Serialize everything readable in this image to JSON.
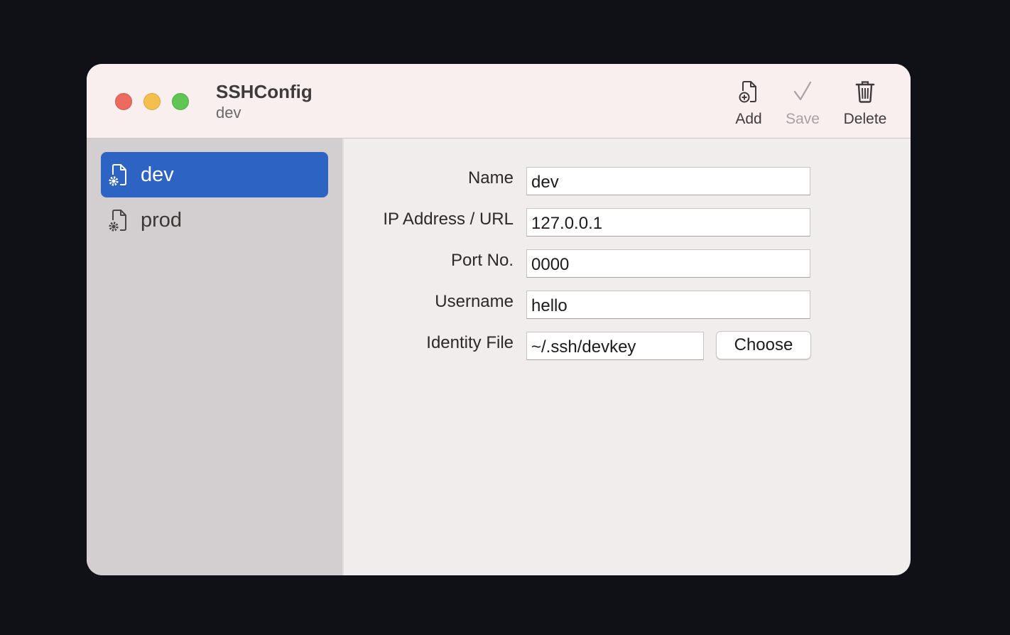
{
  "window": {
    "title": "SSHConfig",
    "subtitle": "dev"
  },
  "toolbar": {
    "add_label": "Add",
    "save_label": "Save",
    "delete_label": "Delete"
  },
  "sidebar": {
    "items": [
      {
        "label": "dev",
        "icon": "gear-document-icon",
        "selected": true
      },
      {
        "label": "prod",
        "icon": "gear-document-icon",
        "selected": false
      }
    ]
  },
  "form": {
    "name_label": "Name",
    "name_value": "dev",
    "ip_label": "IP Address / URL",
    "ip_value": "127.0.0.1",
    "port_label": "Port No.",
    "port_value": "0000",
    "username_label": "Username",
    "username_value": "hello",
    "identity_label": "Identity File",
    "identity_value": "~/.ssh/devkey",
    "choose_label": "Choose"
  },
  "colors": {
    "accent": "#2d63c3",
    "titlebar": "#f9efef",
    "sidebar": "#d3cecf",
    "content": "#f2eded",
    "close": "#ec6a5e",
    "minimize": "#f4bf4f",
    "maximize": "#61c554"
  }
}
